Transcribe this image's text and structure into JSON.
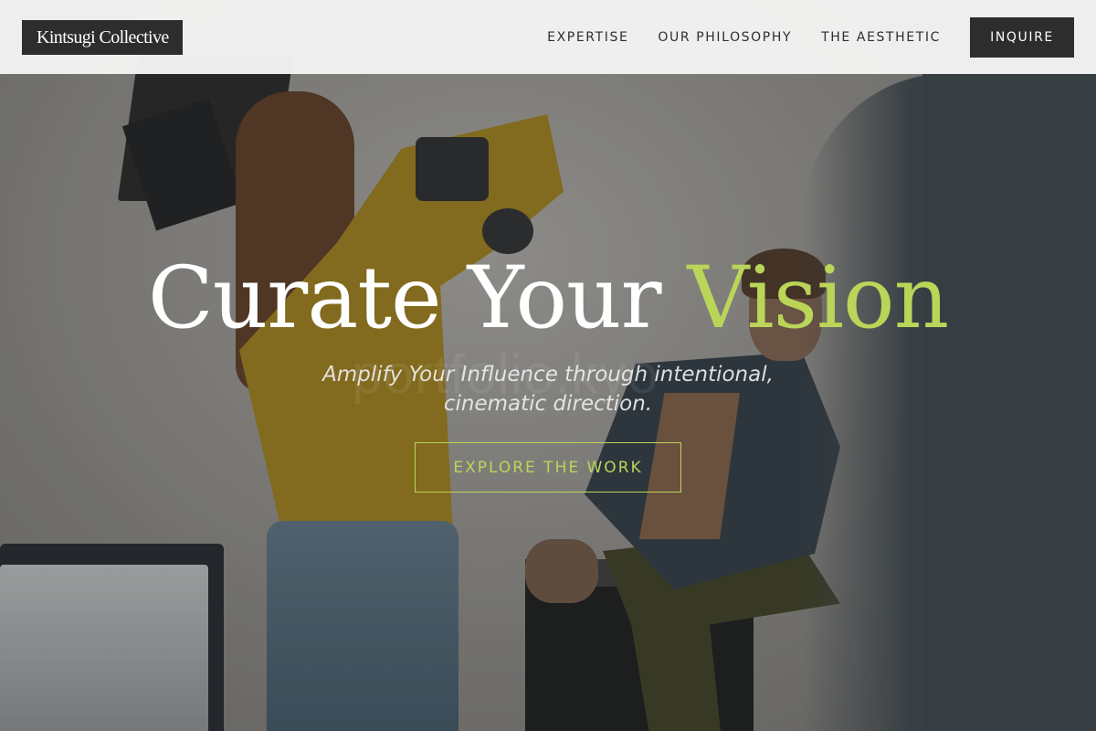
{
  "brand": {
    "logo_text": "Kintsugi Collective"
  },
  "nav": {
    "items": [
      {
        "label": "EXPERTISE"
      },
      {
        "label": "OUR PHILOSOPHY"
      },
      {
        "label": "THE AESTHETIC"
      }
    ],
    "cta_label": "INQUIRE"
  },
  "hero": {
    "title_main": "Curate Your ",
    "title_accent": "Vision",
    "subtitle": "Amplify Your Influence through intentional, cinematic direction.",
    "cta_label": "EXPLORE THE WORK",
    "watermark": "portfolio.kyo"
  },
  "colors": {
    "accent": "#bad558",
    "header_bg": "#f3f3f3",
    "dark": "#2d2d2d"
  }
}
